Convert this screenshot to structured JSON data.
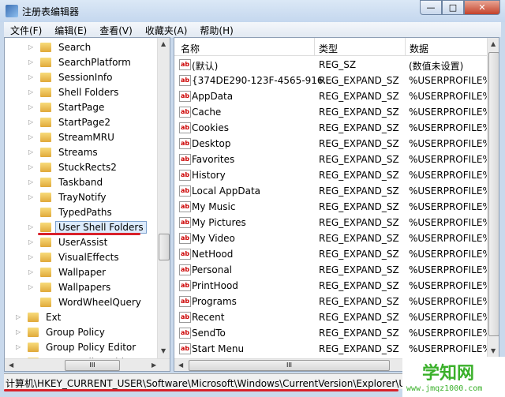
{
  "window": {
    "title": "注册表编辑器",
    "min": "—",
    "max": "□",
    "close": "✕"
  },
  "menu": [
    "文件(F)",
    "编辑(E)",
    "查看(V)",
    "收藏夹(A)",
    "帮助(H)"
  ],
  "tree": [
    {
      "label": "Search",
      "depth": 2
    },
    {
      "label": "SearchPlatform",
      "depth": 2
    },
    {
      "label": "SessionInfo",
      "depth": 2
    },
    {
      "label": "Shell Folders",
      "depth": 2
    },
    {
      "label": "StartPage",
      "depth": 2
    },
    {
      "label": "StartPage2",
      "depth": 2
    },
    {
      "label": "StreamMRU",
      "depth": 2
    },
    {
      "label": "Streams",
      "depth": 2
    },
    {
      "label": "StuckRects2",
      "depth": 2
    },
    {
      "label": "Taskband",
      "depth": 2
    },
    {
      "label": "TrayNotify",
      "depth": 2
    },
    {
      "label": "TypedPaths",
      "depth": 2
    },
    {
      "label": "User Shell Folders",
      "depth": 2,
      "selected": true
    },
    {
      "label": "UserAssist",
      "depth": 2
    },
    {
      "label": "VisualEffects",
      "depth": 2
    },
    {
      "label": "Wallpaper",
      "depth": 2
    },
    {
      "label": "Wallpapers",
      "depth": 2
    },
    {
      "label": "WordWheelQuery",
      "depth": 2
    },
    {
      "label": "Ext",
      "depth": 1
    },
    {
      "label": "Group Policy",
      "depth": 1
    },
    {
      "label": "Group Policy Editor",
      "depth": 1
    },
    {
      "label": "Group Policy Objects",
      "depth": 1
    }
  ],
  "columns": {
    "name": "名称",
    "type": "类型",
    "data": "数据"
  },
  "values": [
    {
      "name": "(默认)",
      "type": "REG_SZ",
      "data": "(数值未设置)"
    },
    {
      "name": "{374DE290-123F-4565-916...",
      "type": "REG_EXPAND_SZ",
      "data": "%USERPROFILE%"
    },
    {
      "name": "AppData",
      "type": "REG_EXPAND_SZ",
      "data": "%USERPROFILE%"
    },
    {
      "name": "Cache",
      "type": "REG_EXPAND_SZ",
      "data": "%USERPROFILE%"
    },
    {
      "name": "Cookies",
      "type": "REG_EXPAND_SZ",
      "data": "%USERPROFILE%"
    },
    {
      "name": "Desktop",
      "type": "REG_EXPAND_SZ",
      "data": "%USERPROFILE%"
    },
    {
      "name": "Favorites",
      "type": "REG_EXPAND_SZ",
      "data": "%USERPROFILE%"
    },
    {
      "name": "History",
      "type": "REG_EXPAND_SZ",
      "data": "%USERPROFILE%"
    },
    {
      "name": "Local AppData",
      "type": "REG_EXPAND_SZ",
      "data": "%USERPROFILE%"
    },
    {
      "name": "My Music",
      "type": "REG_EXPAND_SZ",
      "data": "%USERPROFILE%"
    },
    {
      "name": "My Pictures",
      "type": "REG_EXPAND_SZ",
      "data": "%USERPROFILE%"
    },
    {
      "name": "My Video",
      "type": "REG_EXPAND_SZ",
      "data": "%USERPROFILE%"
    },
    {
      "name": "NetHood",
      "type": "REG_EXPAND_SZ",
      "data": "%USERPROFILE%"
    },
    {
      "name": "Personal",
      "type": "REG_EXPAND_SZ",
      "data": "%USERPROFILE%"
    },
    {
      "name": "PrintHood",
      "type": "REG_EXPAND_SZ",
      "data": "%USERPROFILE%"
    },
    {
      "name": "Programs",
      "type": "REG_EXPAND_SZ",
      "data": "%USERPROFILE%"
    },
    {
      "name": "Recent",
      "type": "REG_EXPAND_SZ",
      "data": "%USERPROFILE%"
    },
    {
      "name": "SendTo",
      "type": "REG_EXPAND_SZ",
      "data": "%USERPROFILE%"
    },
    {
      "name": "Start Menu",
      "type": "REG_EXPAND_SZ",
      "data": "%USERPROFILE%"
    }
  ],
  "value_icon": "ab",
  "status": "计算机\\HKEY_CURRENT_USER\\Software\\Microsoft\\Windows\\CurrentVersion\\Explorer\\User Shell Folders",
  "watermark": {
    "title": "学知网",
    "url": "www.jmqz1000.com"
  },
  "scroll_glyph": "III"
}
